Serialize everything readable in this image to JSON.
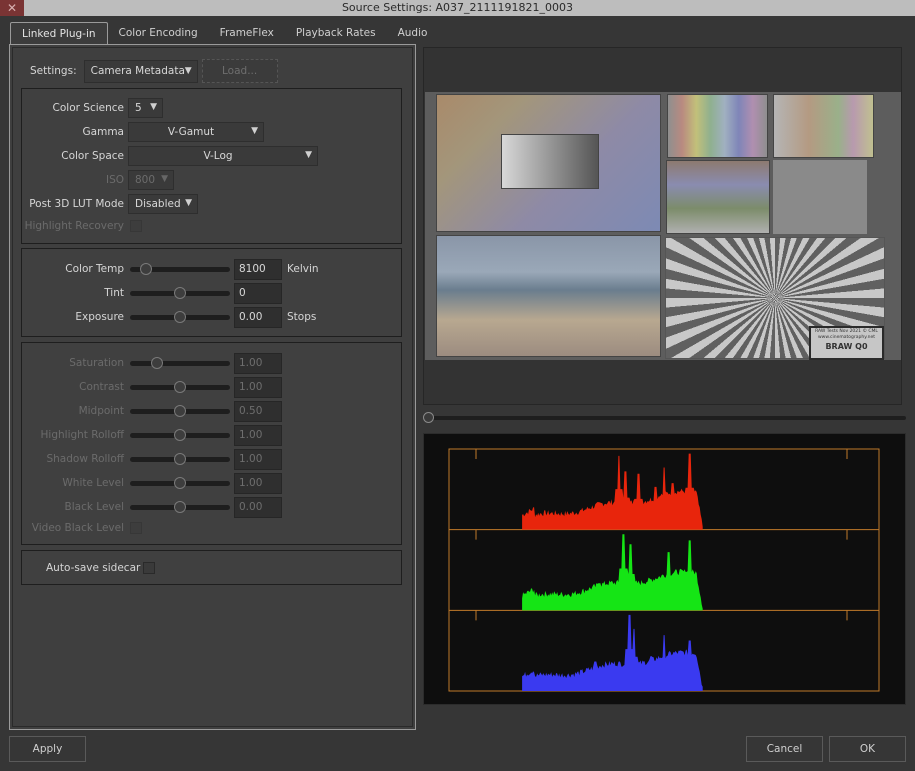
{
  "window": {
    "title": "Source Settings: A037_2111191821_0003",
    "close_glyph": "✕"
  },
  "tabs": [
    {
      "label": "Linked Plug-in",
      "active": true
    },
    {
      "label": "Color Encoding",
      "active": false
    },
    {
      "label": "FrameFlex",
      "active": false
    },
    {
      "label": "Playback Rates",
      "active": false
    },
    {
      "label": "Audio",
      "active": false
    }
  ],
  "settings": {
    "label": "Settings:",
    "value": "Camera Metadata",
    "load_label": "Load..."
  },
  "decode": {
    "color_science": {
      "label": "Color Science",
      "value": "5"
    },
    "gamma": {
      "label": "Gamma",
      "value": "V-Gamut"
    },
    "color_space": {
      "label": "Color Space",
      "value": "V-Log"
    },
    "iso": {
      "label": "ISO",
      "value": "800",
      "disabled": true
    },
    "post_lut": {
      "label": "Post 3D LUT Mode",
      "value": "Disabled"
    },
    "highlight_recovery": {
      "label": "Highlight Recovery",
      "checked": false,
      "disabled": true
    }
  },
  "white_balance": {
    "color_temp": {
      "label": "Color Temp",
      "value": "8100",
      "unit": "Kelvin",
      "slider": 0.16
    },
    "tint": {
      "label": "Tint",
      "value": "0",
      "unit": "",
      "slider": 0.5
    },
    "exposure": {
      "label": "Exposure",
      "value": "0.00",
      "unit": "Stops",
      "slider": 0.5
    }
  },
  "grading": {
    "rows": [
      {
        "label": "Saturation",
        "value": "1.00",
        "slider": 0.27
      },
      {
        "label": "Contrast",
        "value": "1.00",
        "slider": 0.5
      },
      {
        "label": "Midpoint",
        "value": "0.50",
        "slider": 0.5
      },
      {
        "label": "Highlight Rolloff",
        "value": "1.00",
        "slider": 0.5
      },
      {
        "label": "Shadow Rolloff",
        "value": "1.00",
        "slider": 0.5
      },
      {
        "label": "White Level",
        "value": "1.00",
        "slider": 0.5
      },
      {
        "label": "Black Level",
        "value": "0.00",
        "slider": 0.5
      }
    ],
    "video_black_level": {
      "label": "Video Black Level",
      "checked": false,
      "disabled": true
    }
  },
  "auto_save": {
    "label": "Auto-save sidecar",
    "checked": false
  },
  "buttons": {
    "apply": "Apply",
    "cancel": "Cancel",
    "ok": "OK"
  },
  "viewer": {
    "slate_line1": "RAW Tests Nov 2021 © CML",
    "slate_line2": "www.cinematography.net",
    "slate_label": "BRAW Q0",
    "scrub_position": 0
  },
  "histogram": {
    "channels": [
      {
        "name": "red",
        "color": "#e8250c"
      },
      {
        "name": "green",
        "color": "#15e515"
      },
      {
        "name": "blue",
        "color": "#3a3af0"
      }
    ],
    "frame_color": "#c07a2a"
  }
}
